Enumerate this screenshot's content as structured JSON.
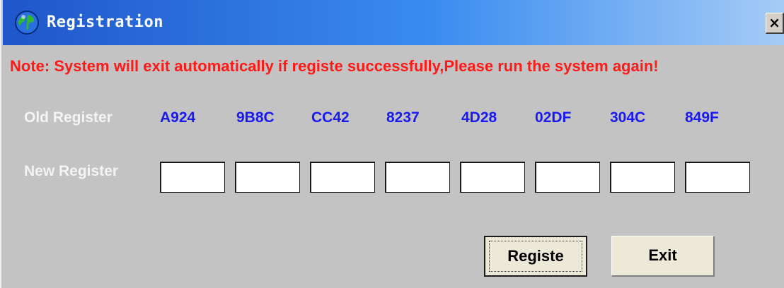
{
  "window": {
    "title": "Registration",
    "close_label": "×",
    "icon": "globe-icon"
  },
  "note": "Note: System will exit automatically if registe successfully,Please run the system again!",
  "old_register": {
    "label": "Old Register",
    "codes": [
      "A924",
      "9B8C",
      "CC42",
      "8237",
      "4D28",
      "02DF",
      "304C",
      "849F"
    ]
  },
  "new_register": {
    "label": "New Register",
    "fields": [
      "",
      "",
      "",
      "",
      "",
      "",
      "",
      ""
    ]
  },
  "buttons": {
    "registe": "Registe",
    "exit": "Exit"
  },
  "colors": {
    "note_text": "#ff1a1a",
    "code_text": "#1a1af0",
    "dialog_background": "#c3c3c3",
    "title_bar": "#1f56c9"
  }
}
